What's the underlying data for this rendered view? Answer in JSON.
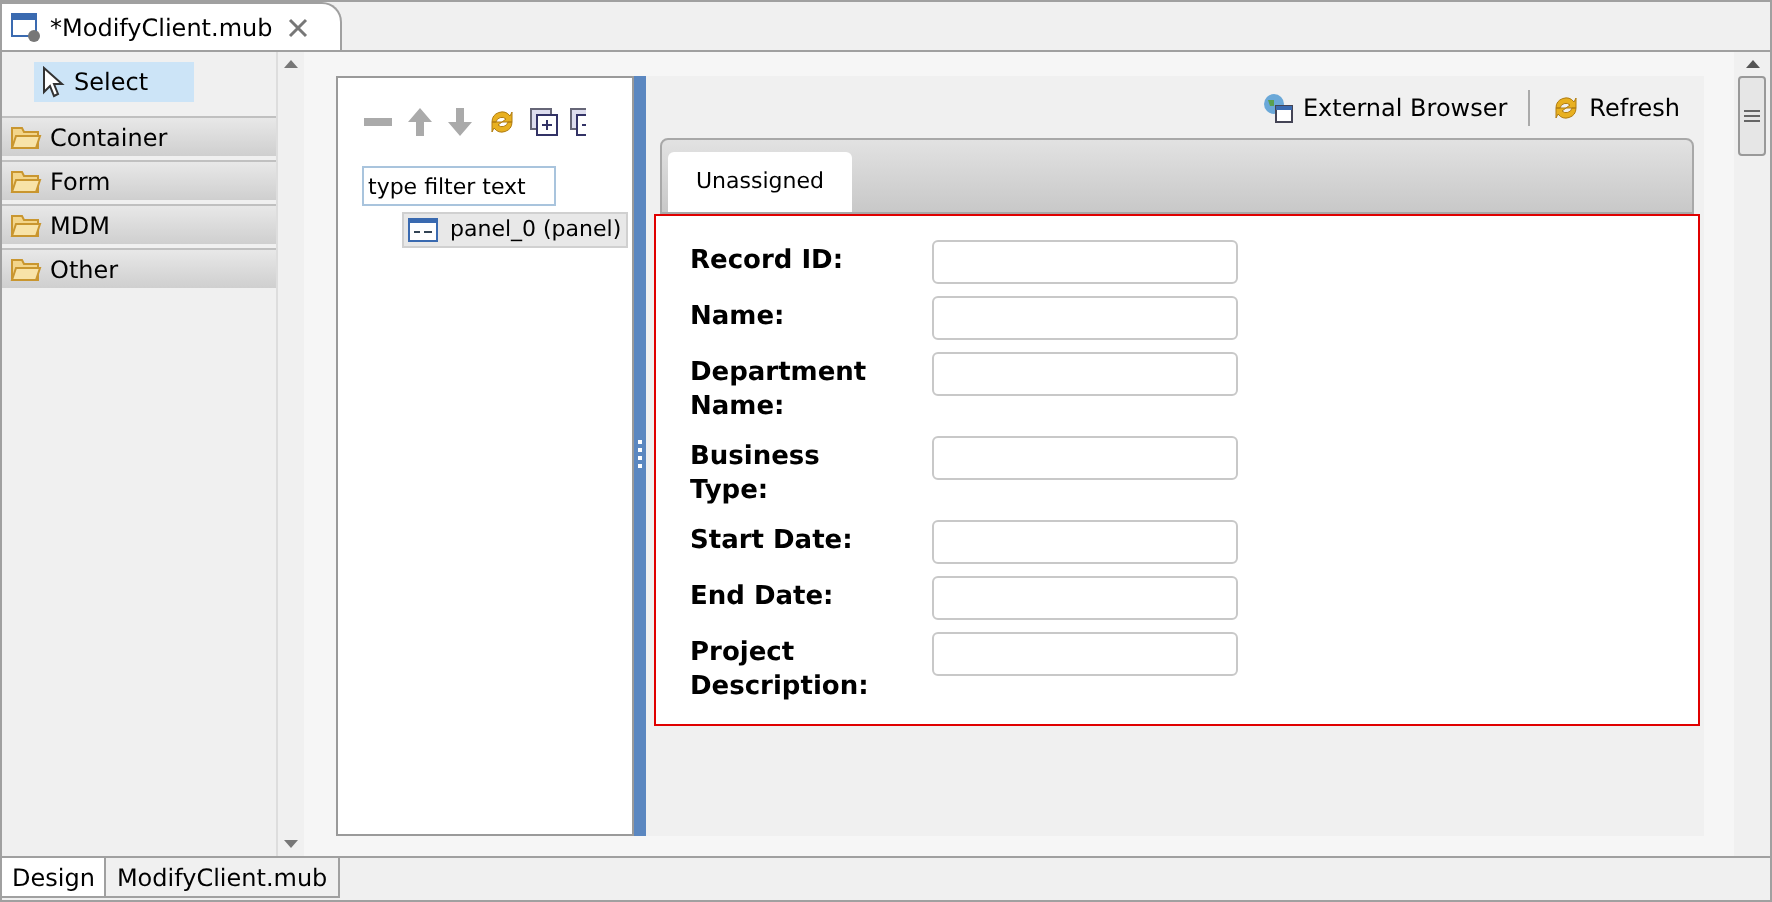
{
  "editor_tab": {
    "title": "*ModifyClient.mub"
  },
  "palette": {
    "tool": {
      "label": "Select",
      "selected": true
    },
    "drawers": [
      {
        "label": "Container"
      },
      {
        "label": "Form"
      },
      {
        "label": "MDM"
      },
      {
        "label": "Other"
      }
    ]
  },
  "outline": {
    "filter": {
      "placeholder": "type filter text"
    },
    "items": [
      {
        "label": "panel_0 (panel)",
        "selected": true
      }
    ]
  },
  "preview": {
    "toolbar": [
      {
        "label": "External Browser",
        "kind": "browser"
      },
      {
        "label": "Refresh",
        "kind": "refresh"
      }
    ],
    "tabs": [
      {
        "label": "Unassigned",
        "selected": true
      }
    ],
    "fields": [
      {
        "label": "Record ID:"
      },
      {
        "label": "Name:"
      },
      {
        "label": "Department Name:"
      },
      {
        "label": "Business Type:"
      },
      {
        "label": "Start Date:"
      },
      {
        "label": "End Date:"
      },
      {
        "label": "Project Description:"
      }
    ]
  },
  "bottom_tabs": [
    {
      "label": "Design",
      "selected": true
    },
    {
      "label": "ModifyClient.mub",
      "selected": false
    }
  ]
}
